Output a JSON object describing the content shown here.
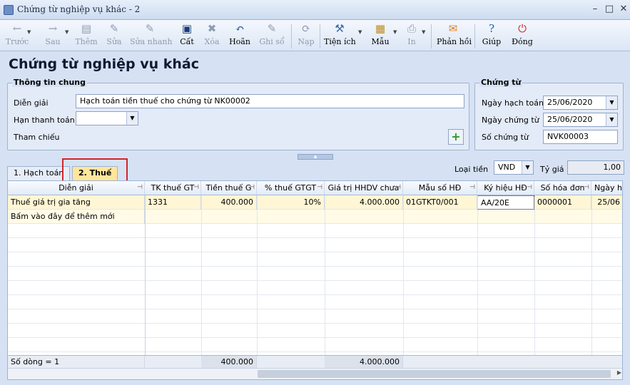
{
  "window": {
    "title": "Chứng từ nghiệp vụ khác - 2"
  },
  "toolbar": [
    {
      "label": "Trước",
      "icon": "←",
      "enabled": false
    },
    {
      "label": "Sau",
      "icon": "→",
      "enabled": false
    },
    {
      "label": "Thêm",
      "icon": "▤",
      "enabled": false
    },
    {
      "label": "Sửa",
      "icon": "✎",
      "enabled": false
    },
    {
      "label": "Sửa nhanh",
      "icon": "✎",
      "enabled": false
    },
    {
      "label": "Cất",
      "icon": "▣",
      "enabled": true
    },
    {
      "label": "Xóa",
      "icon": "✖",
      "enabled": false
    },
    {
      "label": "Hoãn",
      "icon": "↶",
      "enabled": true
    },
    {
      "label": "Ghi sổ",
      "icon": "✎",
      "enabled": false
    },
    {
      "label": "Nạp",
      "icon": "⟳",
      "enabled": false
    },
    {
      "label": "Tiện ích",
      "icon": "⚒",
      "enabled": true
    },
    {
      "label": "Mẫu",
      "icon": "▦",
      "enabled": true
    },
    {
      "label": "In",
      "icon": "⎙",
      "enabled": false
    },
    {
      "label": "Phản hồi",
      "icon": "✉",
      "enabled": true
    },
    {
      "label": "Giúp",
      "icon": "?",
      "enabled": true
    },
    {
      "label": "Đóng",
      "icon": "⏻",
      "enabled": true
    }
  ],
  "heading": "Chứng từ nghiệp vụ khác",
  "general": {
    "title": "Thông tin chung",
    "dien_giai_label": "Diễn giải",
    "dien_giai_value": "Hạch toán tiền thuế cho chứng từ NK00002",
    "han_thanh_toan_label": "Hạn thanh toán",
    "han_thanh_toan_value": "",
    "tham_chieu_label": "Tham chiếu"
  },
  "voucher": {
    "title": "Chứng từ",
    "ngay_hach_toan_label": "Ngày hạch toán",
    "ngay_hach_toan_value": "25/06/2020",
    "ngay_chung_tu_label": "Ngày chứng từ",
    "ngay_chung_tu_value": "25/06/2020",
    "so_chung_tu_label": "Số chứng từ",
    "so_chung_tu_value": "NVK00003"
  },
  "tabs": [
    {
      "label": "1. Hạch toán",
      "active": false
    },
    {
      "label": "2. Thuế",
      "active": true
    }
  ],
  "currency": {
    "label": "Loại tiền",
    "value": "VND",
    "rate_label": "Tỷ giá",
    "rate_value": "1,00"
  },
  "grid": {
    "columns": [
      "Diễn giải",
      "TK thuế GT",
      "Tiền thuế G",
      "% thuế GTGT",
      "Giá trị HHDV chưa",
      "Mẫu số HĐ",
      "Ký hiệu HĐ",
      "Số hóa đơn",
      "Ngày hó"
    ],
    "rows": [
      [
        "Thuế giá trị gia tăng",
        "1331",
        "400.000",
        "10%",
        "4.000.000",
        "01GTKT0/001",
        "AA/20E",
        "0000001",
        "25/06"
      ]
    ],
    "new_row_hint": "Bấm vào đây để thêm mới",
    "footer_count": "Số dòng = 1",
    "footer_tax_total": "400.000",
    "footer_value_total": "4.000.000"
  }
}
